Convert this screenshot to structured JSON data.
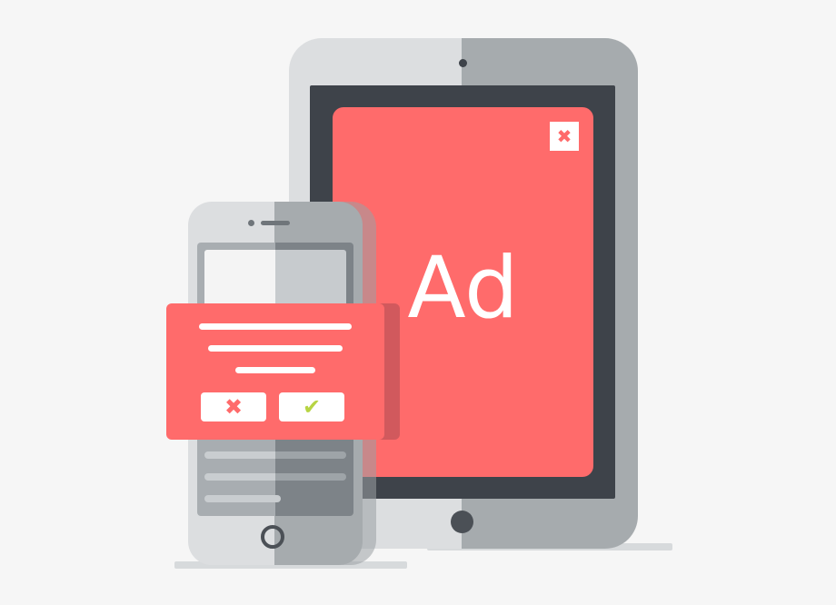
{
  "tablet": {
    "ad_label": "Ad",
    "close_glyph": "✖"
  },
  "popup": {
    "reject_glyph": "✖",
    "accept_glyph": "✔"
  },
  "colors": {
    "ad_red": "#ff6b6b",
    "device_light": "#dcdee0",
    "device_dark": "#a6abae",
    "screen_dark": "#3e434a",
    "accept_green": "#b7d443"
  },
  "icons": [
    "close-icon",
    "reject-icon",
    "accept-icon"
  ]
}
